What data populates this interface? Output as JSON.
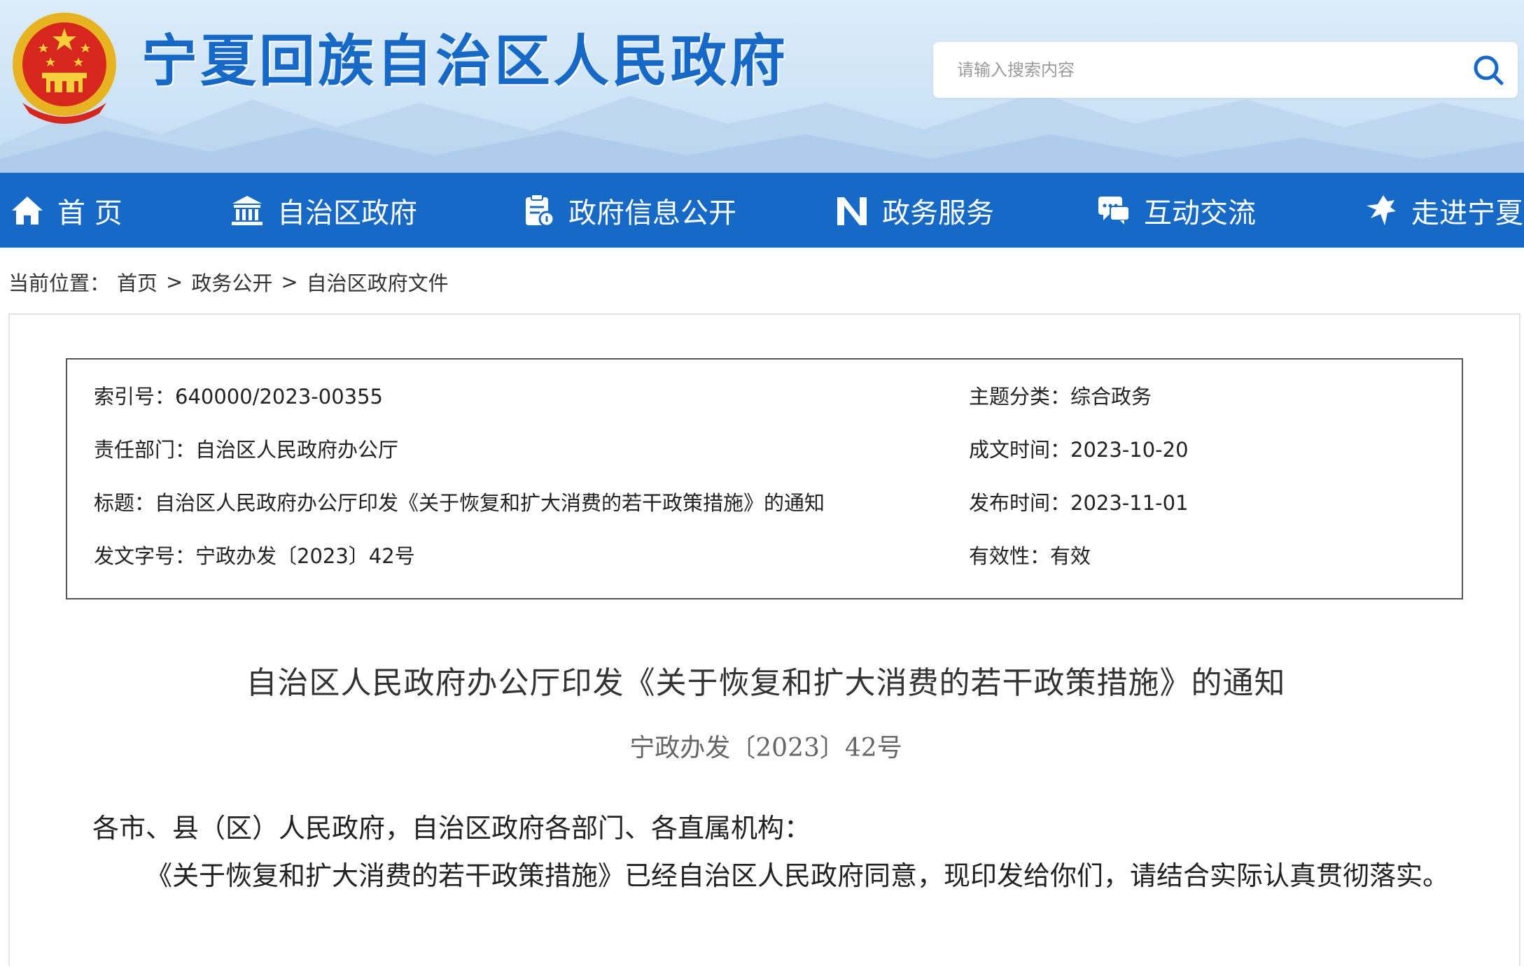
{
  "site": {
    "title": "宁夏回族自治区人民政府",
    "brand_color": "#1769c7"
  },
  "search": {
    "placeholder": "请输入搜索内容",
    "icon": "search-icon"
  },
  "nav": {
    "items": [
      {
        "label": "首 页",
        "icon": "home-icon"
      },
      {
        "label": "自治区政府",
        "icon": "government-building-icon"
      },
      {
        "label": "政府信息公开",
        "icon": "document-info-icon"
      },
      {
        "label": "政务服务",
        "icon": "service-icon"
      },
      {
        "label": "互动交流",
        "icon": "chat-icon"
      },
      {
        "label": "走进宁夏",
        "icon": "landmark-icon"
      }
    ]
  },
  "breadcrumb": {
    "prefix": "当前位置：",
    "items": [
      "首页",
      "政务公开",
      "自治区政府文件"
    ],
    "separator": ">"
  },
  "meta": {
    "index_no": "索引号：640000/2023-00355",
    "topic": "主题分类：综合政务",
    "department": "责任部门：自治区人民政府办公厅",
    "created": "成文时间：2023-10-20",
    "title": "标题：自治区人民政府办公厅印发《关于恢复和扩大消费的若干政策措施》的通知",
    "published": "发布时间：2023-11-01",
    "doc_no": "发文字号：宁政办发〔2023〕42号",
    "validity": "有效性：有效"
  },
  "document": {
    "title": "自治区人民政府办公厅印发《关于恢复和扩大消费的若干政策措施》的通知",
    "number": "宁政办发〔2023〕42号",
    "salutation": "各市、县（区）人民政府，自治区政府各部门、各直属机构：",
    "paragraph1": "《关于恢复和扩大消费的若干政策措施》已经自治区人民政府同意，现印发给你们，请结合实际认真贯彻落实。"
  }
}
